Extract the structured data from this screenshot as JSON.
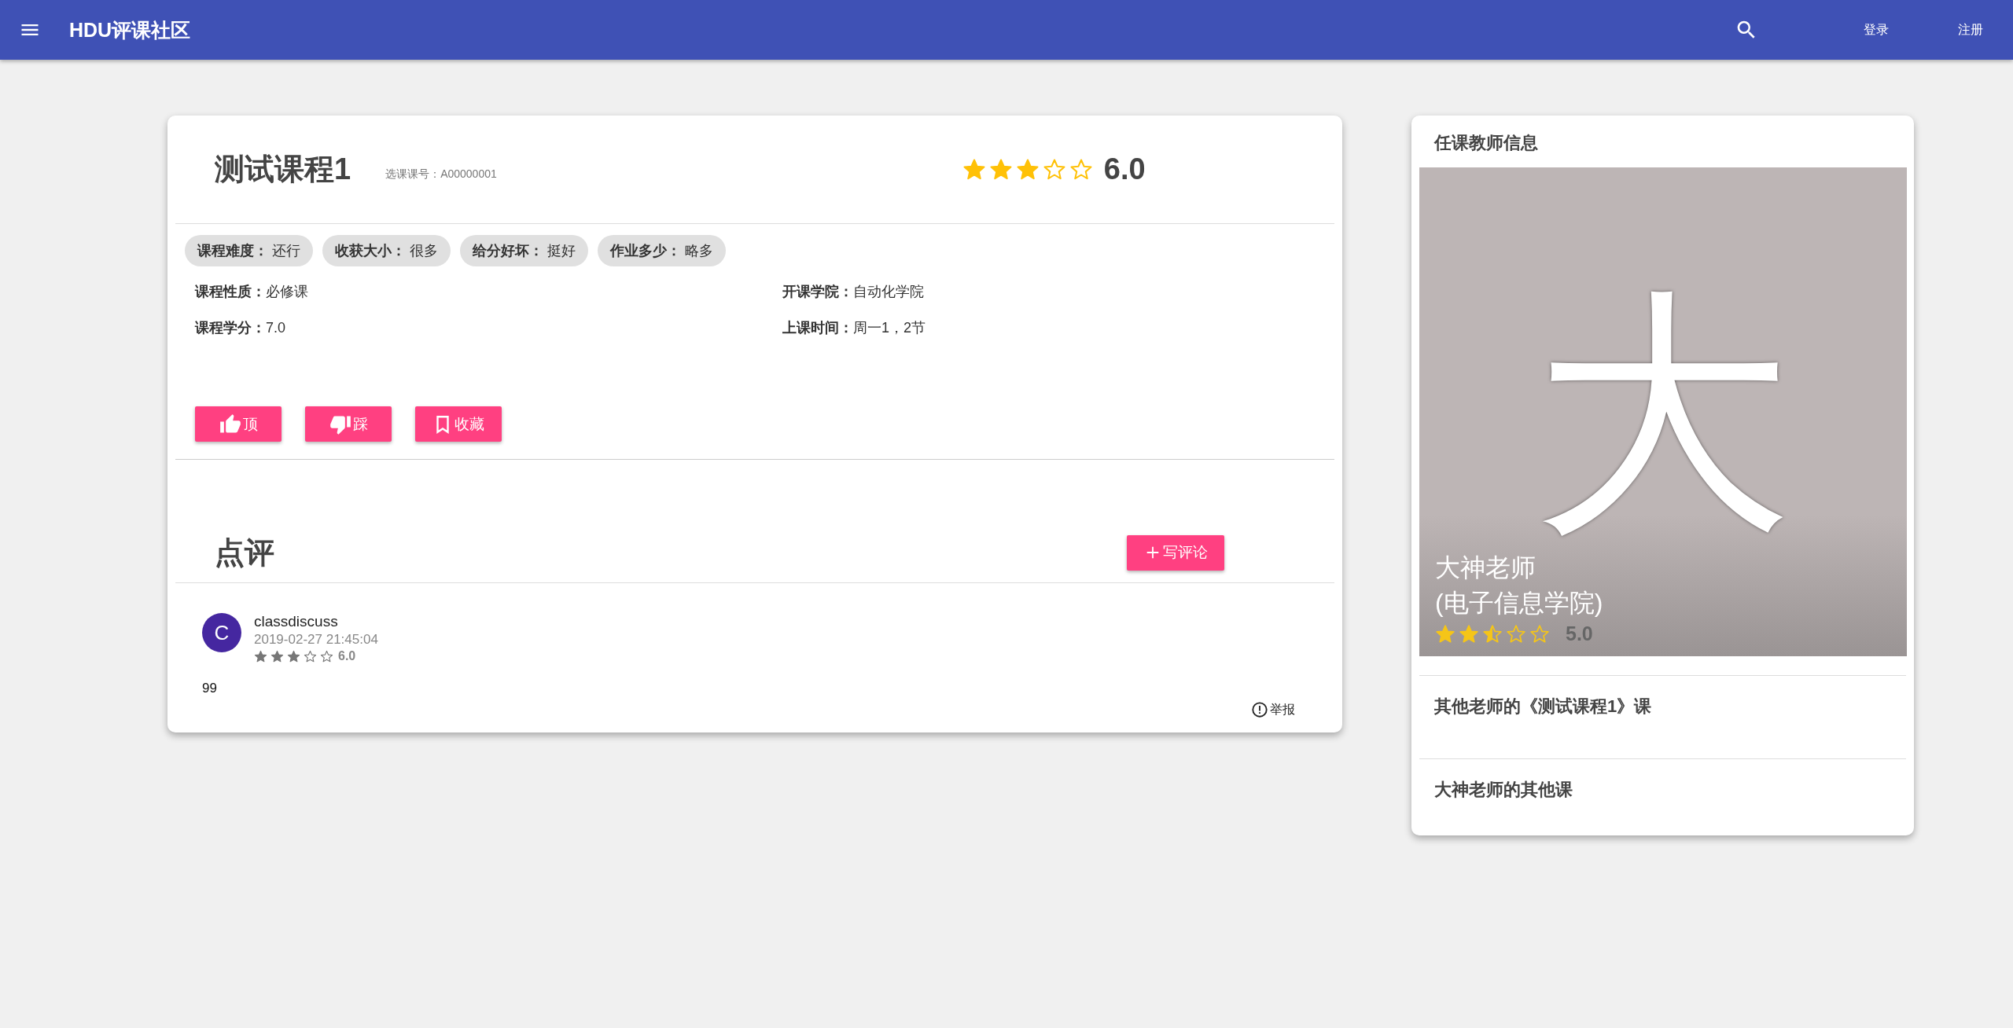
{
  "app_bar": {
    "title": "HDU评课社区",
    "actions": [
      "登录",
      "注册"
    ]
  },
  "course": {
    "title": "测试课程1",
    "code": "选课课号：A00000001",
    "stars": 3,
    "score": "6.0",
    "tags": [
      "**课程难度：** 还行",
      "**收获大小：** 很多",
      "**给分好坏：** 挺好",
      "**作业多少：** 略多"
    ],
    "info": [
      "**课程性质：**必修课",
      "**开课学院：**自动化学院",
      "**课程学分：**7.0",
      "**上课时间：**周一1，2节"
    ],
    "actions": [
      {
        "kind": "like",
        "label": "顶"
      },
      {
        "kind": "dislike",
        "label": "踩"
      },
      {
        "kind": "bookmark",
        "label": "收藏"
      }
    ]
  },
  "reviews": {
    "title": "点评",
    "write_button": "写评论",
    "items": [
      {
        "avatar": "C",
        "user": "classdiscuss",
        "time": "2019-02-27 21:45:04",
        "stars": 3,
        "score": "6.0",
        "text": "99",
        "report": "举报"
      }
    ]
  },
  "teacher_panel": {
    "title": "任课教师信息",
    "avatar_letter": "大",
    "name": "大神老师",
    "college": "(电子信息学院)",
    "stars": 2.5,
    "score": "5.0",
    "links": [
      "其他老师的《测试课程1》课",
      "大神老师的其他课"
    ]
  }
}
